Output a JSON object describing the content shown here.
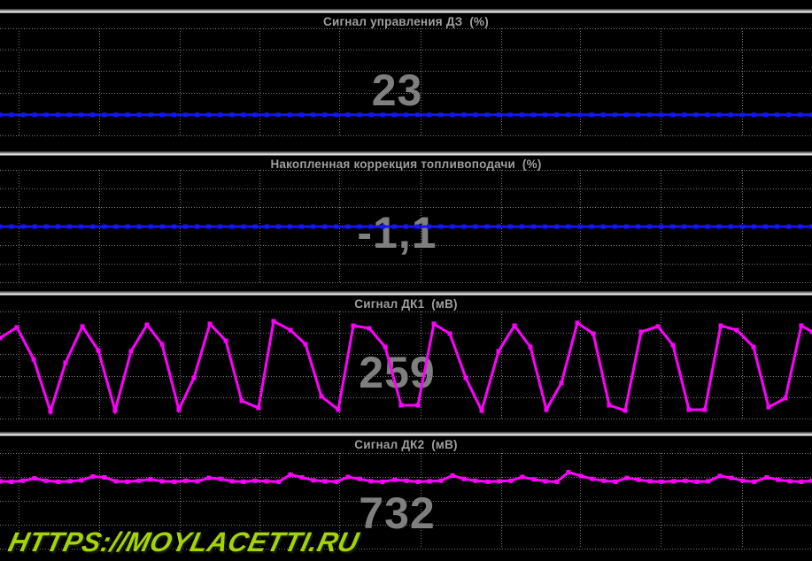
{
  "page": {
    "background": "#000000",
    "grid_color": "#787878",
    "title_color": "#9e9e9e",
    "value_color": "#7f7f7f"
  },
  "watermark": {
    "text": "HTTPS://MOYLACETTI.RU",
    "color": "#a4d408"
  },
  "chart_data": [
    {
      "type": "line",
      "title": "Сигнал управления ДЗ  (%)",
      "display_value": "23",
      "unit": "%",
      "color": "#1414ff",
      "ylim": [
        0,
        120
      ],
      "grid": true,
      "constant_value": 23,
      "n_points": 71
    },
    {
      "type": "line",
      "title": "Накопленная коррекция топливоподачи  (%)",
      "display_value": "-1,1",
      "unit": "%",
      "color": "#1414ff",
      "ylim": [
        -11,
        9
      ],
      "grid": true,
      "constant_value": -1.1,
      "n_points": 71
    },
    {
      "type": "line",
      "title": "Сигнал ДК1  (мВ)",
      "display_value": "259",
      "unit": "мВ",
      "color": "#ff00ff",
      "ylim": [
        0,
        1000
      ],
      "grid": true,
      "points": [
        [
          0,
          752
        ],
        [
          19,
          851
        ],
        [
          38,
          554
        ],
        [
          57,
          66
        ],
        [
          74,
          521
        ],
        [
          93,
          860
        ],
        [
          111,
          636
        ],
        [
          130,
          74
        ],
        [
          148,
          628
        ],
        [
          166,
          876
        ],
        [
          183,
          694
        ],
        [
          202,
          83
        ],
        [
          219,
          380
        ],
        [
          237,
          884
        ],
        [
          255,
          727
        ],
        [
          273,
          165
        ],
        [
          292,
          99
        ],
        [
          309,
          909
        ],
        [
          328,
          826
        ],
        [
          345,
          694
        ],
        [
          363,
          207
        ],
        [
          382,
          83
        ],
        [
          399,
          868
        ],
        [
          417,
          843
        ],
        [
          435,
          669
        ],
        [
          453,
          124
        ],
        [
          472,
          124
        ],
        [
          490,
          884
        ],
        [
          508,
          793
        ],
        [
          526,
          380
        ],
        [
          544,
          74
        ],
        [
          563,
          628
        ],
        [
          581,
          868
        ],
        [
          599,
          669
        ],
        [
          617,
          83
        ],
        [
          634,
          331
        ],
        [
          652,
          893
        ],
        [
          670,
          793
        ],
        [
          688,
          124
        ],
        [
          706,
          74
        ],
        [
          724,
          810
        ],
        [
          743,
          860
        ],
        [
          760,
          686
        ],
        [
          778,
          83
        ],
        [
          796,
          83
        ],
        [
          814,
          868
        ],
        [
          832,
          826
        ],
        [
          851,
          669
        ],
        [
          868,
          107
        ],
        [
          887,
          190
        ],
        [
          905,
          868
        ],
        [
          917,
          810
        ]
      ]
    },
    {
      "type": "line",
      "title": "Сигнал ДК2  (мВ)",
      "display_value": "732",
      "unit": "мВ",
      "color": "#ff00ff",
      "ylim": [
        0,
        1000
      ],
      "grid": true,
      "points": [
        [
          0,
          705
        ],
        [
          13,
          700
        ],
        [
          26,
          710
        ],
        [
          39,
          735
        ],
        [
          52,
          710
        ],
        [
          66,
          700
        ],
        [
          79,
          705
        ],
        [
          92,
          715
        ],
        [
          105,
          755
        ],
        [
          118,
          745
        ],
        [
          131,
          705
        ],
        [
          144,
          700
        ],
        [
          157,
          710
        ],
        [
          170,
          725
        ],
        [
          183,
          705
        ],
        [
          197,
          700
        ],
        [
          210,
          710
        ],
        [
          223,
          705
        ],
        [
          236,
          740
        ],
        [
          249,
          730
        ],
        [
          262,
          705
        ],
        [
          275,
          700
        ],
        [
          288,
          710
        ],
        [
          301,
          705
        ],
        [
          315,
          700
        ],
        [
          328,
          775
        ],
        [
          341,
          745
        ],
        [
          354,
          715
        ],
        [
          367,
          705
        ],
        [
          380,
          700
        ],
        [
          393,
          750
        ],
        [
          406,
          730
        ],
        [
          419,
          705
        ],
        [
          432,
          700
        ],
        [
          446,
          720
        ],
        [
          459,
          710
        ],
        [
          472,
          700
        ],
        [
          485,
          705
        ],
        [
          498,
          710
        ],
        [
          511,
          765
        ],
        [
          524,
          730
        ],
        [
          537,
          710
        ],
        [
          551,
          700
        ],
        [
          564,
          705
        ],
        [
          577,
          710
        ],
        [
          590,
          750
        ],
        [
          603,
          725
        ],
        [
          616,
          705
        ],
        [
          629,
          700
        ],
        [
          642,
          800
        ],
        [
          656,
          760
        ],
        [
          669,
          730
        ],
        [
          682,
          710
        ],
        [
          695,
          700
        ],
        [
          708,
          740
        ],
        [
          721,
          720
        ],
        [
          734,
          705
        ],
        [
          747,
          700
        ],
        [
          761,
          705
        ],
        [
          774,
          710
        ],
        [
          787,
          700
        ],
        [
          800,
          705
        ],
        [
          813,
          760
        ],
        [
          826,
          740
        ],
        [
          839,
          710
        ],
        [
          852,
          700
        ],
        [
          866,
          745
        ],
        [
          879,
          720
        ],
        [
          892,
          705
        ],
        [
          905,
          700
        ],
        [
          917,
          710
        ]
      ]
    }
  ]
}
